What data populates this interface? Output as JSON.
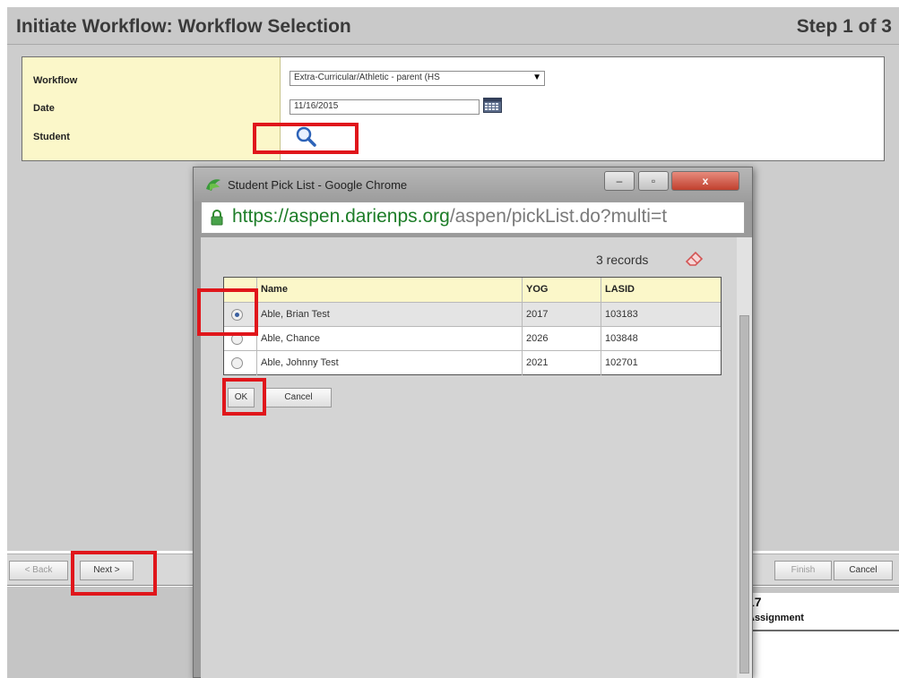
{
  "page": {
    "title": "Initiate Workflow: Workflow Selection",
    "step": "Step 1 of 3"
  },
  "form": {
    "workflow_label": "Workflow",
    "workflow_value": "Extra-Curricular/Athletic - parent (HS",
    "date_label": "Date",
    "date_value": "11/16/2015",
    "student_label": "Student"
  },
  "footer": {
    "back": "< Back",
    "next": "Next >",
    "finish": "Finish",
    "cancel": "Cancel"
  },
  "lower": {
    "number": "17",
    "assignment": "Assignment"
  },
  "modal": {
    "title": "Student Pick List - Google Chrome",
    "url_main": "https://aspen.darienps.org",
    "url_rest": "/aspen/pickList.do?multi=t",
    "records": "3 records",
    "columns": [
      "Name",
      "YOG",
      "LASID"
    ],
    "rows": [
      {
        "name": "Able, Brian Test",
        "yog": "2017",
        "lasid": "103183",
        "selected": true
      },
      {
        "name": "Able, Chance",
        "yog": "2026",
        "lasid": "103848",
        "selected": false
      },
      {
        "name": "Able, Johnny Test",
        "yog": "2021",
        "lasid": "102701",
        "selected": false
      }
    ],
    "ok": "OK",
    "cancel": "Cancel"
  },
  "colors": {
    "header_bg": "#c9c9c9",
    "label_bg": "#fbf7c9",
    "annotation_red": "#e0161b",
    "url_green": "#1d7d28"
  }
}
